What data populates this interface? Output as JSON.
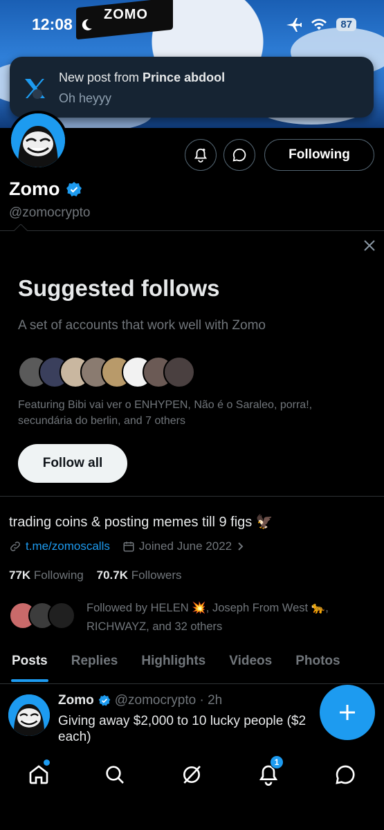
{
  "status_bar": {
    "time": "12:08",
    "battery": "87"
  },
  "banner": {
    "flag_text": "ZOMO"
  },
  "notification": {
    "prefix": "New post from ",
    "author": "Prince abdool",
    "message": "Oh heyyy"
  },
  "profile": {
    "name": "Zomo",
    "handle": "@zomocrypto",
    "following_button": "Following",
    "bio": "trading coins & posting memes till 9 figs 🦅",
    "link": "t.me/zomoscalls",
    "joined": "Joined June 2022",
    "following_count": "77K",
    "following_label": "Following",
    "followers_count": "70.7K",
    "followers_label": "Followers",
    "followed_by": "Followed by HELEN 💥, Joseph From West 🐆, RICHWAYZ, and 32 others"
  },
  "suggested": {
    "title": "Suggested follows",
    "subtitle": "A set of accounts that work well with Zomo",
    "featuring": "Featuring Bibi vai ver o ENHYPEN, Não é o Saraleo, porra!, secundária do berlin, and 7 others",
    "follow_all": "Follow all"
  },
  "tabs": [
    "Posts",
    "Replies",
    "Highlights",
    "Videos",
    "Photos"
  ],
  "post": {
    "name": "Zomo",
    "meta": "@zomocrypto · 2h",
    "text_line1": "Giving away $2,000 to 10 lucky people ($2",
    "text_line2": "each)"
  },
  "bottom_nav": {
    "notifications_badge": "1"
  },
  "colors": {
    "accent": "#1d9bf0",
    "background": "#000000",
    "muted": "#71767b"
  }
}
